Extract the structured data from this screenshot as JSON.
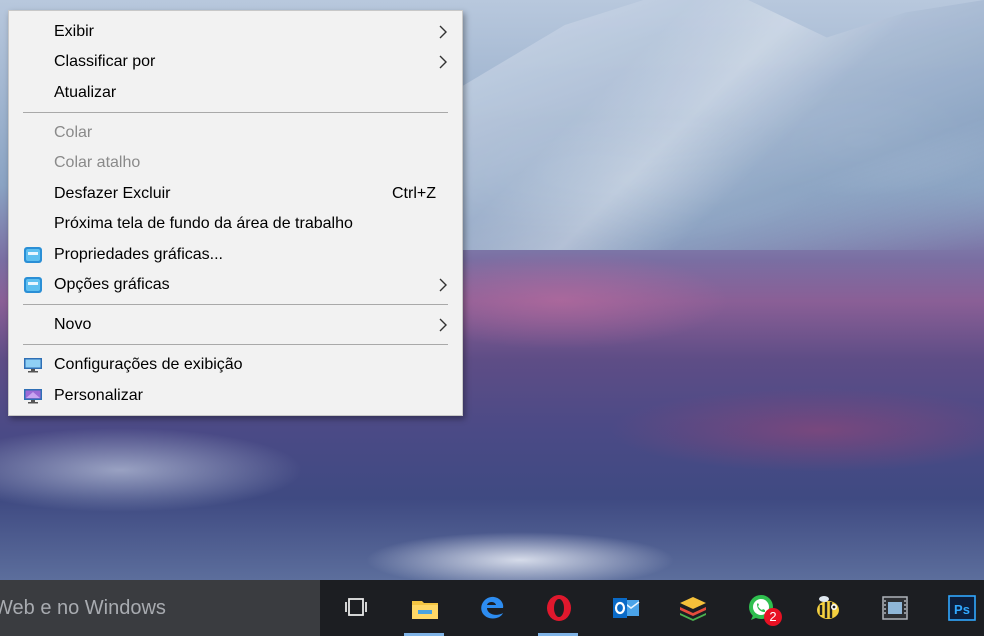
{
  "context_menu": {
    "items": [
      {
        "label": "Exibir"
      },
      {
        "label": "Classificar por"
      },
      {
        "label": "Atualizar"
      },
      {
        "label": "Colar"
      },
      {
        "label": "Colar atalho"
      },
      {
        "label": "Desfazer Excluir",
        "shortcut": "Ctrl+Z"
      },
      {
        "label": "Próxima tela de fundo da área de trabalho"
      },
      {
        "label": "Propriedades gráficas..."
      },
      {
        "label": "Opções gráficas"
      },
      {
        "label": "Novo"
      },
      {
        "label": "Configurações de exibição"
      },
      {
        "label": "Personalizar"
      }
    ]
  },
  "taskbar": {
    "search_text": "Web e no Windows",
    "apps": [
      {
        "icon": "task-view-icon"
      },
      {
        "icon": "file-explorer-icon"
      },
      {
        "icon": "edge-icon"
      },
      {
        "icon": "opera-icon"
      },
      {
        "icon": "outlook-icon"
      },
      {
        "icon": "bluestacks-icon"
      },
      {
        "icon": "whatsapp-icon",
        "badge": "2"
      },
      {
        "icon": "bee-app-icon"
      },
      {
        "icon": "video-editor-icon"
      },
      {
        "icon": "photoshop-icon",
        "label": "Ps"
      }
    ]
  },
  "colors": {
    "menu_bg": "#f2f2f2",
    "taskbar_bg": "#1c1e22",
    "active_underline": "#7fb3e6",
    "badge_red": "#e81123"
  }
}
